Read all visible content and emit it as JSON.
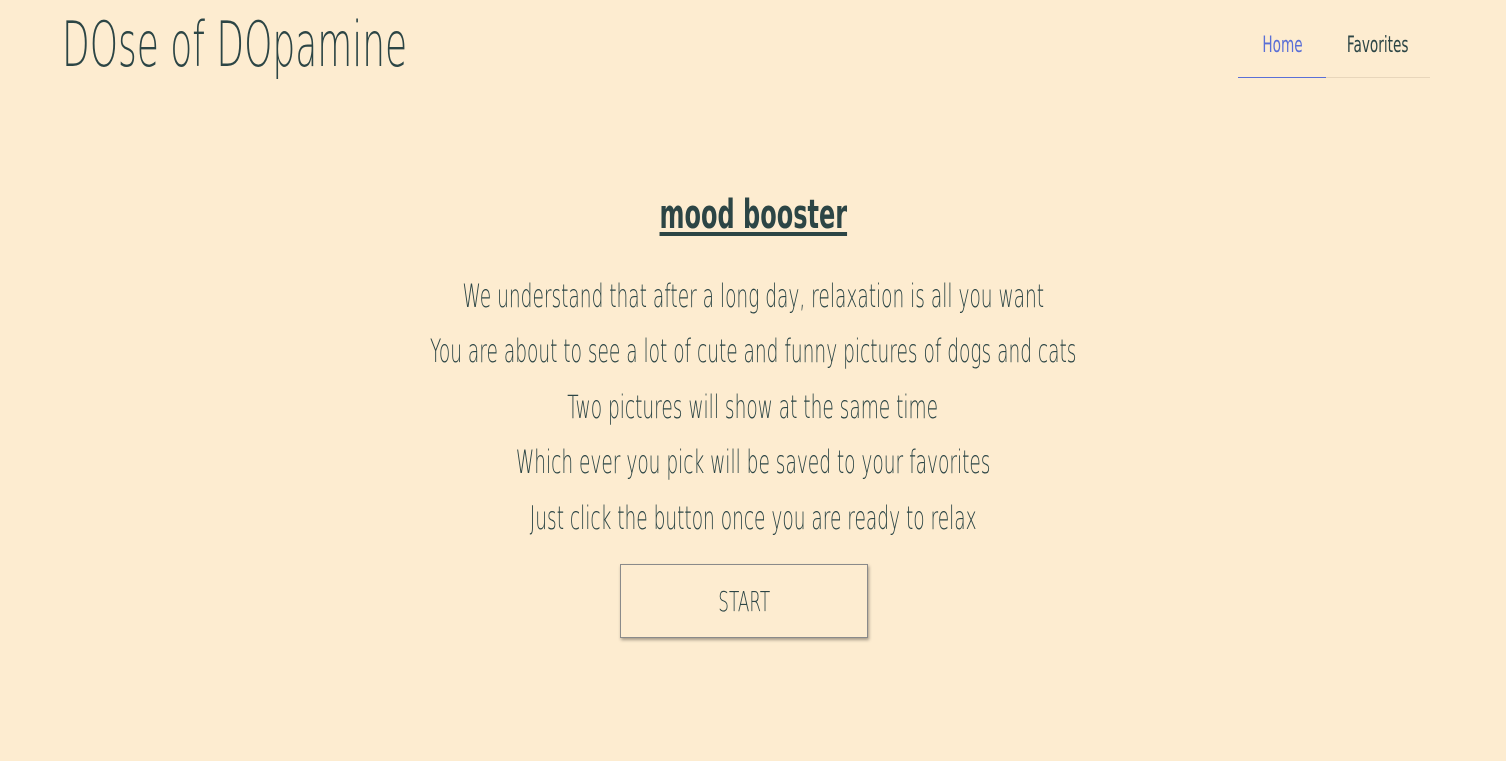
{
  "header": {
    "brand": "DOse of DOpamine",
    "nav": [
      {
        "label": "Home",
        "active": true
      },
      {
        "label": "Favorites",
        "active": false
      }
    ]
  },
  "main": {
    "heading": "mood booster",
    "lines": [
      "We understand that after a long day, relaxation is all you want",
      "You are about to see a lot of cute and funny pictures of dogs and cats",
      "Two pictures will show at the same time",
      "Which ever you pick will be saved to your favorites",
      "Just click the button once you are ready to relax"
    ],
    "start_label": "START"
  },
  "colors": {
    "background": "#fdecd0",
    "text": "#2c4545",
    "accent": "#5a6fd6"
  }
}
